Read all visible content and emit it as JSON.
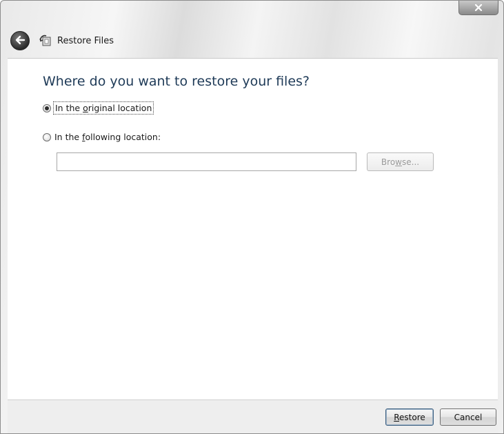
{
  "window": {
    "title": "Restore Files"
  },
  "main": {
    "heading": "Where do you want to restore your files?",
    "options": [
      {
        "pre": "In the ",
        "accel": "o",
        "post": "riginal location",
        "checked": true
      },
      {
        "pre": "In the ",
        "accel": "f",
        "post": "ollowing location:",
        "checked": false
      }
    ],
    "location_input": {
      "value": "",
      "placeholder": ""
    },
    "browse": {
      "pre": "Bro",
      "accel": "w",
      "post": "se...",
      "enabled": false
    }
  },
  "footer": {
    "restore": {
      "pre": "",
      "accel": "R",
      "post": "estore"
    },
    "cancel_label": "Cancel"
  },
  "icons": {
    "close": "close-icon",
    "back": "back-arrow-icon",
    "app": "restore-files-icon"
  },
  "colors": {
    "heading": "#1e3a57",
    "content_bg": "#ffffff",
    "footer_bg": "#eeeeee"
  }
}
